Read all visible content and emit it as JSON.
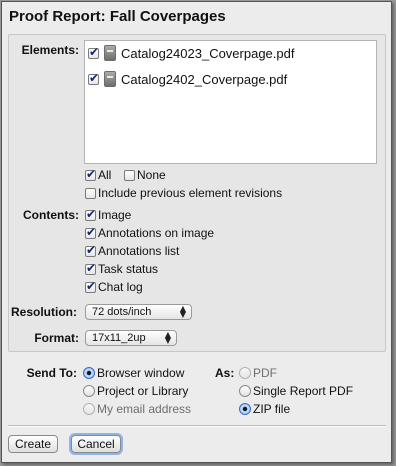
{
  "title": "Proof Report: Fall Coverpages",
  "elements": {
    "label": "Elements:",
    "files": [
      {
        "name": "Catalog24023_Coverpage.pdf",
        "checked": true
      },
      {
        "name": "Catalog2402_Coverpage.pdf",
        "checked": true
      }
    ],
    "all_label": "All",
    "none_label": "None",
    "include_revisions_label": "Include previous element revisions"
  },
  "contents": {
    "label": "Contents:",
    "items": [
      {
        "label": "Image",
        "checked": true
      },
      {
        "label": "Annotations on image",
        "checked": true
      },
      {
        "label": "Annotations list",
        "checked": true
      },
      {
        "label": "Task status",
        "checked": true
      },
      {
        "label": "Chat log",
        "checked": true
      }
    ]
  },
  "resolution": {
    "label": "Resolution:",
    "value": "72 dots/inch"
  },
  "format": {
    "label": "Format:",
    "value": "17x11_2up"
  },
  "send_to": {
    "label": "Send To:",
    "options": [
      {
        "label": "Browser window",
        "selected": true
      },
      {
        "label": "Project or Library",
        "selected": false
      },
      {
        "label": "My email address",
        "selected": false
      }
    ]
  },
  "as": {
    "label": "As:",
    "options": [
      {
        "label": "PDF",
        "selected": false
      },
      {
        "label": "Single Report PDF",
        "selected": false
      },
      {
        "label": "ZIP file",
        "selected": true
      }
    ]
  },
  "buttons": {
    "create": "Create",
    "cancel": "Cancel"
  }
}
